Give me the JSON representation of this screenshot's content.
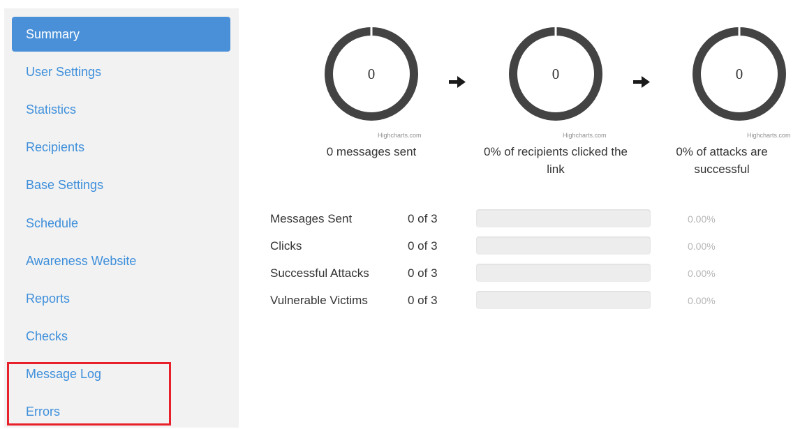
{
  "sidebar": {
    "items": [
      {
        "label": "Summary",
        "active": true
      },
      {
        "label": "User Settings",
        "active": false
      },
      {
        "label": "Statistics",
        "active": false
      },
      {
        "label": "Recipients",
        "active": false
      },
      {
        "label": "Base Settings",
        "active": false
      },
      {
        "label": "Schedule",
        "active": false
      },
      {
        "label": "Awareness Website",
        "active": false
      },
      {
        "label": "Reports",
        "active": false
      },
      {
        "label": "Checks",
        "active": false
      },
      {
        "label": "Message Log",
        "active": false
      },
      {
        "label": "Errors",
        "active": false
      }
    ],
    "highlight_color": "#e8202a",
    "active_color": "#4a90d9",
    "link_color": "#3e8fdb"
  },
  "gauges": [
    {
      "value": "0",
      "fraction": 0,
      "credit": "Highcharts.com",
      "caption_line1": "0 messages sent",
      "caption_line2": ""
    },
    {
      "value": "0",
      "fraction": 0,
      "credit": "Highcharts.com",
      "caption_line1": "0% of recipients clicked the",
      "caption_line2": "link"
    },
    {
      "value": "0",
      "fraction": 0,
      "credit": "Highcharts.com",
      "caption_line1": "0% of attacks are",
      "caption_line2": "successful"
    }
  ],
  "arrows": [
    {
      "icon": "arrow-right-icon"
    },
    {
      "icon": "arrow-right-icon"
    }
  ],
  "stats": [
    {
      "label": "Messages Sent",
      "count": "0 of 3",
      "percent": "0.00%",
      "fraction": 0
    },
    {
      "label": "Clicks",
      "count": "0 of 3",
      "percent": "0.00%",
      "fraction": 0
    },
    {
      "label": "Successful Attacks",
      "count": "0 of 3",
      "percent": "0.00%",
      "fraction": 0
    },
    {
      "label": "Vulnerable Victims",
      "count": "0 of 3",
      "percent": "0.00%",
      "fraction": 0
    }
  ]
}
